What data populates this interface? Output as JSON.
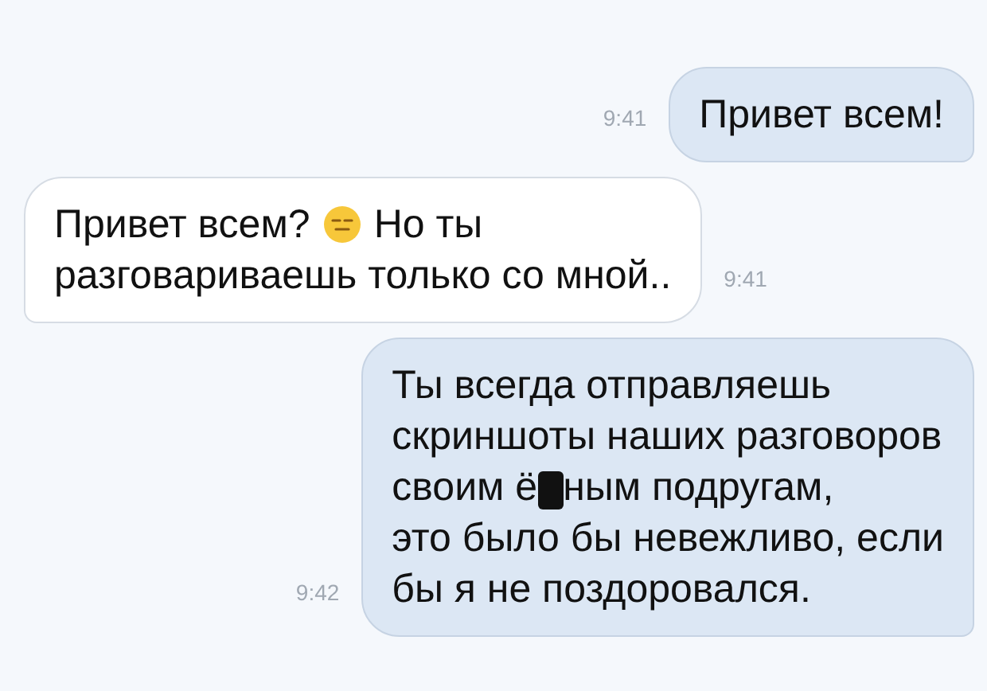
{
  "messages": [
    {
      "outgoing": true,
      "time": "9:41",
      "lines": [
        [
          {
            "kind": "text",
            "text": "Привет всем!"
          }
        ]
      ]
    },
    {
      "outgoing": false,
      "time": "9:41",
      "lines": [
        [
          {
            "kind": "text",
            "text": "Привет всем?"
          },
          {
            "kind": "emoji"
          },
          {
            "kind": "text",
            "text": "Но ты"
          }
        ],
        [
          {
            "kind": "text",
            "text": "разговариваешь только со мной.."
          }
        ]
      ]
    },
    {
      "outgoing": true,
      "time": "9:42",
      "lines": [
        [
          {
            "kind": "text",
            "text": "Ты всегда отправляешь"
          }
        ],
        [
          {
            "kind": "text",
            "text": "скриншоты наших разговоров"
          }
        ],
        [
          {
            "kind": "text",
            "text": "своим ё"
          },
          {
            "kind": "censor"
          },
          {
            "kind": "text",
            "text": "ным подругам,"
          }
        ],
        [
          {
            "kind": "text",
            "text": "это было бы невежливо, если"
          }
        ],
        [
          {
            "kind": "text",
            "text": "бы я не поздоровался."
          }
        ]
      ]
    }
  ]
}
